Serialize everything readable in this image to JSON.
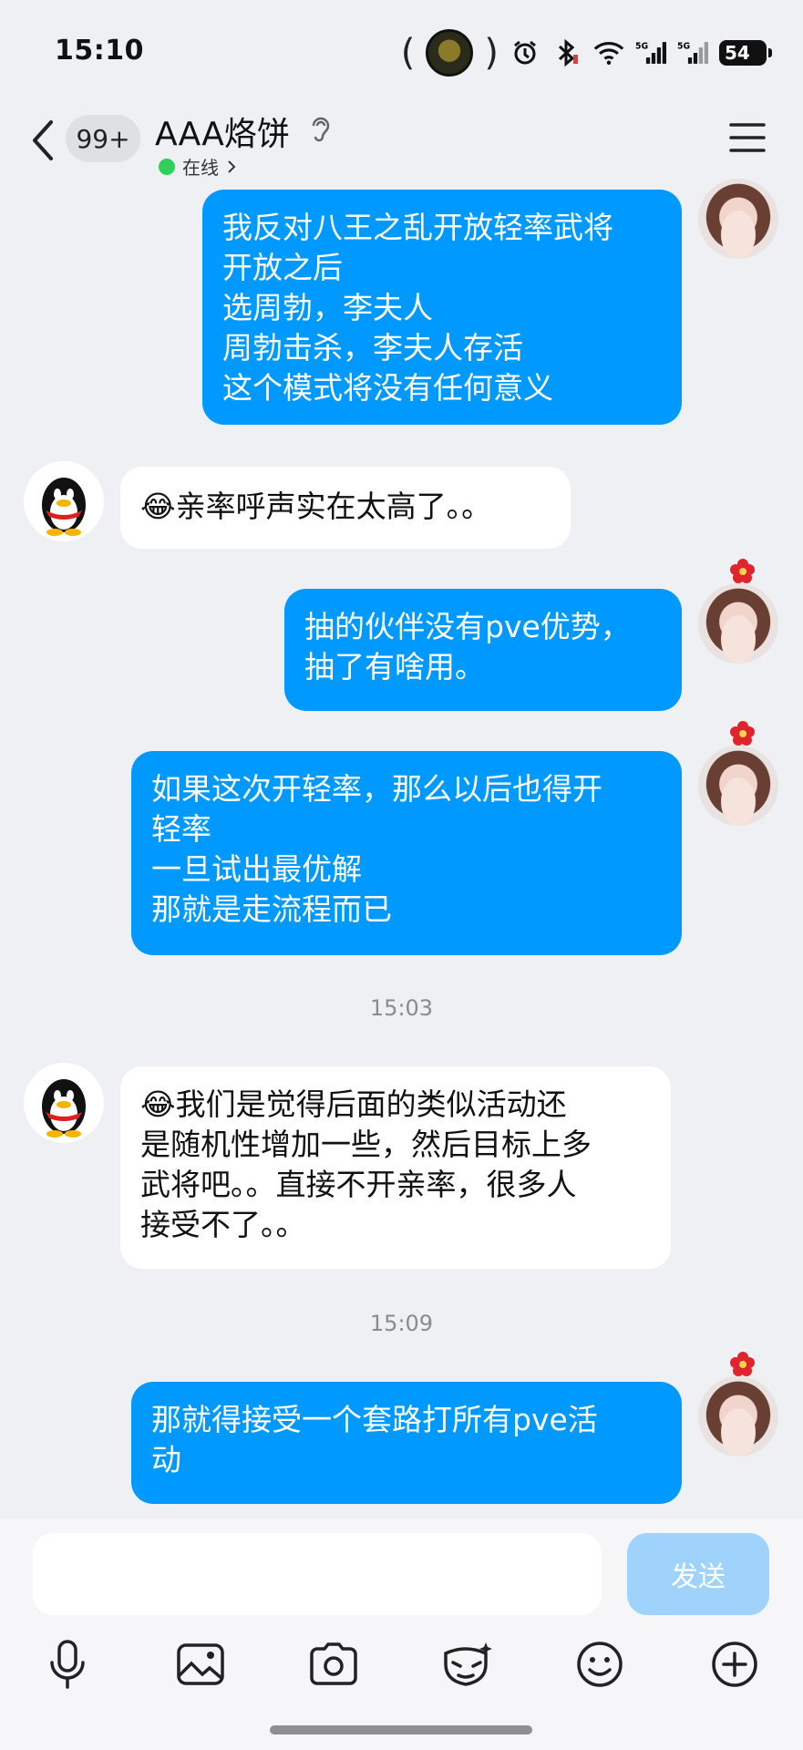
{
  "status_bar": {
    "time": "15:10",
    "battery": "54"
  },
  "header": {
    "back_label": "<",
    "unread_badge": "99+",
    "title": "AAA烙饼",
    "online_status": "在线"
  },
  "messages": [
    {
      "side": "sent",
      "lines": [
        "我反对八王之乱开放轻率武将",
        "开放之后",
        "选周勃，李夫人",
        "周勃击杀，李夫人存活",
        "这个模式将没有任何意义"
      ]
    },
    {
      "side": "recv",
      "emoji": "😂",
      "lines": [
        "亲率呼声实在太高了。。"
      ]
    },
    {
      "side": "sent",
      "lines": [
        "抽的伙伴没有pve优势，",
        "抽了有啥用。"
      ]
    },
    {
      "side": "sent",
      "lines": [
        "如果这次开轻率，那么以后也得开",
        "轻率",
        "一旦试出最优解",
        "那就是走流程而已"
      ]
    },
    {
      "side": "time",
      "text": "15:03"
    },
    {
      "side": "recv",
      "emoji": "😂",
      "lines": [
        "我们是觉得后面的类似活动还",
        "是随机性增加一些，然后目标上多",
        "武将吧。。直接不开亲率，很多人",
        "接受不了。。"
      ]
    },
    {
      "side": "time",
      "text": "15:09"
    },
    {
      "side": "sent",
      "lines": [
        "那就得接受一个套路打所有pve活",
        "动"
      ]
    }
  ],
  "input": {
    "placeholder": "",
    "send_label": "发送"
  },
  "toolbar": [
    "microphone-icon",
    "image-icon",
    "camera-icon",
    "mask-icon",
    "emoji-icon",
    "plus-icon"
  ],
  "colors": {
    "sent_bubble": "#0099ff",
    "recv_bubble": "#ffffff",
    "background": "#eff0f3",
    "online_dot": "#2fd15b",
    "send_disabled": "#9fd3fb"
  }
}
